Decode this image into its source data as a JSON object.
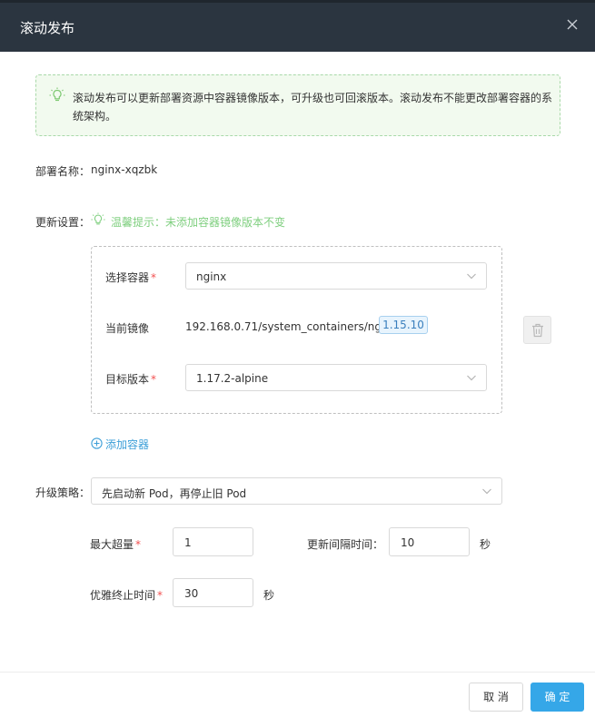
{
  "dialog": {
    "title": "滚动发布"
  },
  "notice": {
    "text": "滚动发布可以更新部署资源中容器镜像版本，可升级也可回滚版本。滚动发布不能更改部署容器的系统架构。"
  },
  "deployment": {
    "label": "部署名称：",
    "value": "nginx-xqzbk"
  },
  "update_settings": {
    "label": "更新设置：",
    "hint": "温馨提示：未添加容器镜像版本不变"
  },
  "container": {
    "select_label": "选择容器",
    "select_value": "nginx",
    "current_image_label": "当前镜像",
    "current_image_value": "192.168.0.71/system_containers/nginx：",
    "current_image_tag": "1.15.10",
    "target_label": "目标版本",
    "target_value": "1.17.2-alpine"
  },
  "add_container": "添加容器",
  "strategy": {
    "label": "升级策略：",
    "value": "先启动新 Pod，再停止旧 Pod"
  },
  "params": {
    "max_surge_label": "最大超量",
    "max_surge_value": "1",
    "interval_label": "更新间隔时间",
    "interval_value": "10",
    "interval_unit": "秒",
    "grace_label": "优雅终止时间",
    "grace_value": "30",
    "grace_unit": "秒"
  },
  "buttons": {
    "cancel": "取 消",
    "ok": "确 定"
  },
  "colors": {
    "header_bg": "#2b3540",
    "primary": "#35a7e8",
    "hint_green": "#7fcf7f",
    "required": "#f25050"
  }
}
